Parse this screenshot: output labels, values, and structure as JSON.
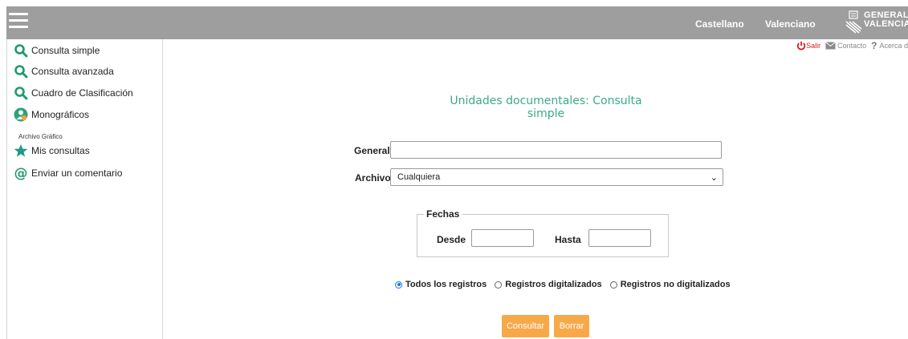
{
  "header": {
    "lang_es": "Castellano",
    "lang_va": "Valenciano",
    "logo_line1": "GENERALITAT",
    "logo_line2": "VALENCIANA",
    "bar_color": "#9e9e9e"
  },
  "sidebar": {
    "items": [
      {
        "label": "Consulta simple",
        "icon": "search-icon"
      },
      {
        "label": "Consulta avanzada",
        "icon": "search-icon"
      },
      {
        "label": "Cuadro de Clasificación",
        "icon": "search-icon"
      },
      {
        "label": "Monográficos",
        "icon": "people-icon"
      }
    ],
    "section_heading": "Archivo Gráfico",
    "items2": [
      {
        "label": "Mis consultas",
        "icon": "star-icon"
      },
      {
        "label": "Enviar un comentario",
        "icon": "at-icon"
      }
    ]
  },
  "top_links": {
    "salir": "Salir",
    "contacto": "Contacto",
    "acerca": "Acerca d"
  },
  "main": {
    "title": "Unidades documentales: Consulta simple",
    "general_label": "General",
    "general_value": "",
    "archivo_label": "Archivo",
    "archivo_selected": "Cualquiera",
    "fechas_legend": "Fechas",
    "desde_label": "Desde",
    "hasta_label": "Hasta",
    "radios": [
      {
        "label": "Todos los registros",
        "checked": true
      },
      {
        "label": "Registros digitalizados",
        "checked": false
      },
      {
        "label": "Registros no digitalizados",
        "checked": false
      }
    ],
    "consultar_label": "Consultar",
    "borrar_label": "Borrar"
  },
  "colors": {
    "accent_green": "#3aaa8a",
    "button_orange": "#f7a94a",
    "salir_red": "#d92020"
  }
}
